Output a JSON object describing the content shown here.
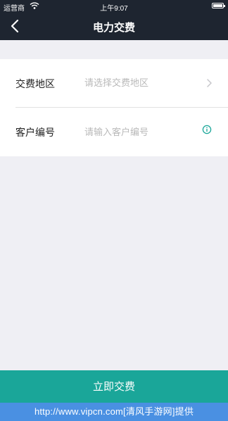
{
  "status_bar": {
    "carrier": "运营商",
    "time": "上午9:07",
    "wifi_icon": "wifi-icon",
    "battery_icon": "battery-icon",
    "battery_level": 1.0
  },
  "nav": {
    "title": "电力交费",
    "back_icon": "chevron-left-icon"
  },
  "form": {
    "region": {
      "label": "交费地区",
      "placeholder": "请选择交费地区",
      "icon": "chevron-right-icon"
    },
    "customer": {
      "label": "客户编号",
      "placeholder": "请输入客户编号",
      "icon": "info-icon"
    }
  },
  "submit": {
    "label": "立即交费"
  },
  "watermark": {
    "text": "http://www.vipcn.com[清风手游网]提供"
  },
  "colors": {
    "header_bg": "#1e2530",
    "accent": "#1aa699",
    "page_bg": "#efeff4",
    "watermark_bg": "#4a90e2"
  }
}
